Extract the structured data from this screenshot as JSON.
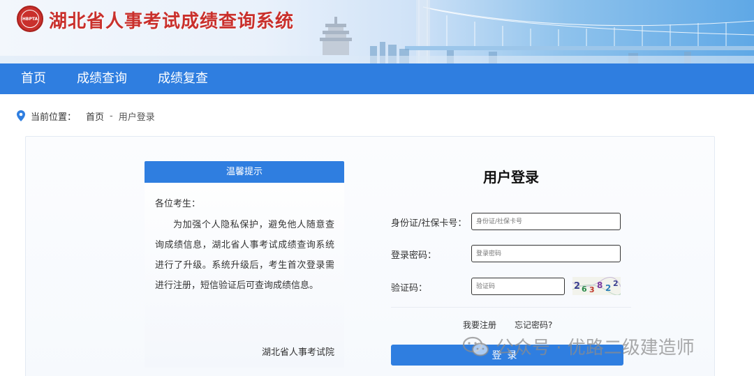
{
  "header": {
    "site_title": "湖北省人事考试成绩查询系统",
    "logo_text": "HBPTA"
  },
  "nav": {
    "items": [
      {
        "label": "首页"
      },
      {
        "label": "成绩查询"
      },
      {
        "label": "成绩复查"
      }
    ]
  },
  "breadcrumb": {
    "prefix": "当前位置：",
    "home": "首页",
    "separator": "-",
    "current": "用户登录"
  },
  "notice": {
    "title": "温馨提示",
    "greeting": "各位考生：",
    "body": "为加强个人隐私保护，避免他人随意查询成绩信息，湖北省人事考试成绩查询系统进行了升级。系统升级后，考生首次登录需进行注册，短信验证后可查询成绩信息。",
    "signature": "湖北省人事考试院"
  },
  "login": {
    "title": "用户登录",
    "id_label": "身份证/社保卡号：",
    "id_placeholder": "身份证/社保卡号",
    "password_label": "登录密码：",
    "password_placeholder": "登录密码",
    "captcha_label": "验证码：",
    "captcha_placeholder": "验证码",
    "captcha_chars": [
      "2",
      "6",
      "3",
      "8",
      "2",
      "2"
    ],
    "register_link": "我要注册",
    "forgot_link": "忘记密码?",
    "submit_label": "登录"
  },
  "watermark": {
    "text": "公众号 · 优路二级建造师"
  },
  "colors": {
    "primary": "#2f7ee0",
    "title_red": "#c9302c"
  }
}
